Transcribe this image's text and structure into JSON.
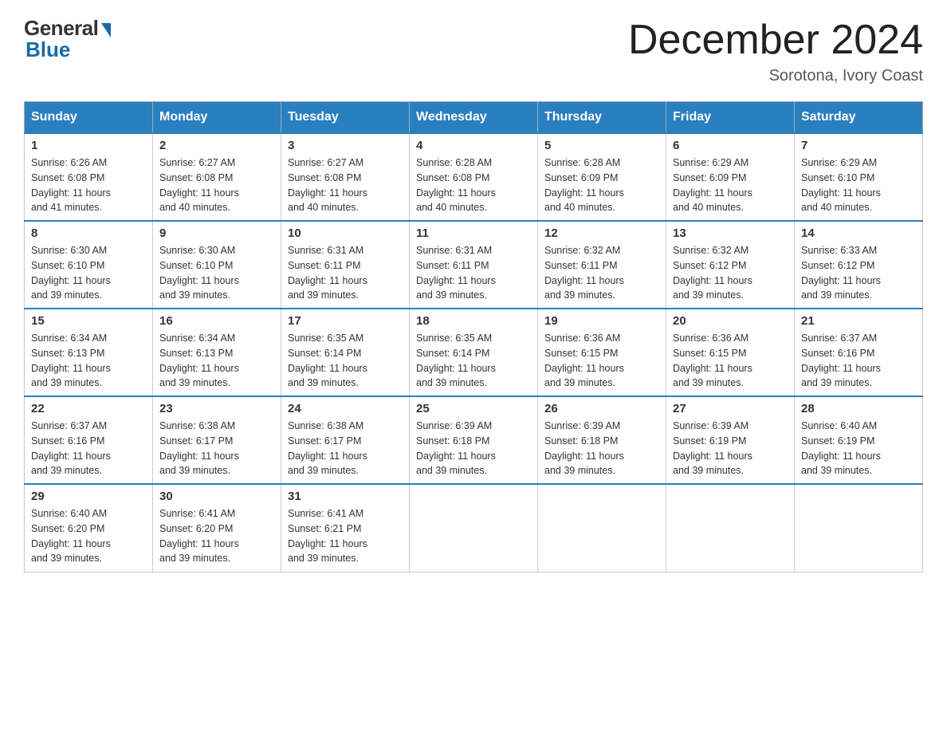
{
  "header": {
    "logo_general": "General",
    "logo_blue": "Blue",
    "month_title": "December 2024",
    "subtitle": "Sorotona, Ivory Coast"
  },
  "days_of_week": [
    "Sunday",
    "Monday",
    "Tuesday",
    "Wednesday",
    "Thursday",
    "Friday",
    "Saturday"
  ],
  "weeks": [
    [
      {
        "day": "1",
        "sunrise": "6:26 AM",
        "sunset": "6:08 PM",
        "daylight": "11 hours and 41 minutes."
      },
      {
        "day": "2",
        "sunrise": "6:27 AM",
        "sunset": "6:08 PM",
        "daylight": "11 hours and 40 minutes."
      },
      {
        "day": "3",
        "sunrise": "6:27 AM",
        "sunset": "6:08 PM",
        "daylight": "11 hours and 40 minutes."
      },
      {
        "day": "4",
        "sunrise": "6:28 AM",
        "sunset": "6:08 PM",
        "daylight": "11 hours and 40 minutes."
      },
      {
        "day": "5",
        "sunrise": "6:28 AM",
        "sunset": "6:09 PM",
        "daylight": "11 hours and 40 minutes."
      },
      {
        "day": "6",
        "sunrise": "6:29 AM",
        "sunset": "6:09 PM",
        "daylight": "11 hours and 40 minutes."
      },
      {
        "day": "7",
        "sunrise": "6:29 AM",
        "sunset": "6:10 PM",
        "daylight": "11 hours and 40 minutes."
      }
    ],
    [
      {
        "day": "8",
        "sunrise": "6:30 AM",
        "sunset": "6:10 PM",
        "daylight": "11 hours and 39 minutes."
      },
      {
        "day": "9",
        "sunrise": "6:30 AM",
        "sunset": "6:10 PM",
        "daylight": "11 hours and 39 minutes."
      },
      {
        "day": "10",
        "sunrise": "6:31 AM",
        "sunset": "6:11 PM",
        "daylight": "11 hours and 39 minutes."
      },
      {
        "day": "11",
        "sunrise": "6:31 AM",
        "sunset": "6:11 PM",
        "daylight": "11 hours and 39 minutes."
      },
      {
        "day": "12",
        "sunrise": "6:32 AM",
        "sunset": "6:11 PM",
        "daylight": "11 hours and 39 minutes."
      },
      {
        "day": "13",
        "sunrise": "6:32 AM",
        "sunset": "6:12 PM",
        "daylight": "11 hours and 39 minutes."
      },
      {
        "day": "14",
        "sunrise": "6:33 AM",
        "sunset": "6:12 PM",
        "daylight": "11 hours and 39 minutes."
      }
    ],
    [
      {
        "day": "15",
        "sunrise": "6:34 AM",
        "sunset": "6:13 PM",
        "daylight": "11 hours and 39 minutes."
      },
      {
        "day": "16",
        "sunrise": "6:34 AM",
        "sunset": "6:13 PM",
        "daylight": "11 hours and 39 minutes."
      },
      {
        "day": "17",
        "sunrise": "6:35 AM",
        "sunset": "6:14 PM",
        "daylight": "11 hours and 39 minutes."
      },
      {
        "day": "18",
        "sunrise": "6:35 AM",
        "sunset": "6:14 PM",
        "daylight": "11 hours and 39 minutes."
      },
      {
        "day": "19",
        "sunrise": "6:36 AM",
        "sunset": "6:15 PM",
        "daylight": "11 hours and 39 minutes."
      },
      {
        "day": "20",
        "sunrise": "6:36 AM",
        "sunset": "6:15 PM",
        "daylight": "11 hours and 39 minutes."
      },
      {
        "day": "21",
        "sunrise": "6:37 AM",
        "sunset": "6:16 PM",
        "daylight": "11 hours and 39 minutes."
      }
    ],
    [
      {
        "day": "22",
        "sunrise": "6:37 AM",
        "sunset": "6:16 PM",
        "daylight": "11 hours and 39 minutes."
      },
      {
        "day": "23",
        "sunrise": "6:38 AM",
        "sunset": "6:17 PM",
        "daylight": "11 hours and 39 minutes."
      },
      {
        "day": "24",
        "sunrise": "6:38 AM",
        "sunset": "6:17 PM",
        "daylight": "11 hours and 39 minutes."
      },
      {
        "day": "25",
        "sunrise": "6:39 AM",
        "sunset": "6:18 PM",
        "daylight": "11 hours and 39 minutes."
      },
      {
        "day": "26",
        "sunrise": "6:39 AM",
        "sunset": "6:18 PM",
        "daylight": "11 hours and 39 minutes."
      },
      {
        "day": "27",
        "sunrise": "6:39 AM",
        "sunset": "6:19 PM",
        "daylight": "11 hours and 39 minutes."
      },
      {
        "day": "28",
        "sunrise": "6:40 AM",
        "sunset": "6:19 PM",
        "daylight": "11 hours and 39 minutes."
      }
    ],
    [
      {
        "day": "29",
        "sunrise": "6:40 AM",
        "sunset": "6:20 PM",
        "daylight": "11 hours and 39 minutes."
      },
      {
        "day": "30",
        "sunrise": "6:41 AM",
        "sunset": "6:20 PM",
        "daylight": "11 hours and 39 minutes."
      },
      {
        "day": "31",
        "sunrise": "6:41 AM",
        "sunset": "6:21 PM",
        "daylight": "11 hours and 39 minutes."
      },
      null,
      null,
      null,
      null
    ]
  ],
  "labels": {
    "sunrise": "Sunrise:",
    "sunset": "Sunset:",
    "daylight": "Daylight:"
  }
}
